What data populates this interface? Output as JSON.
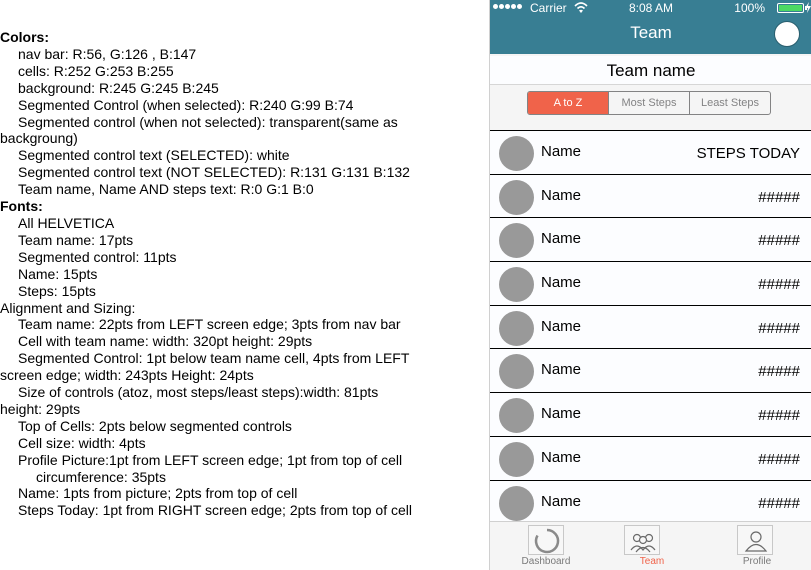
{
  "spec": {
    "lines": [
      {
        "text": "Colors:",
        "level": 0,
        "bold": true
      },
      {
        "text": "nav bar: R:56, G:126 , B:147",
        "level": 1,
        "bold": false
      },
      {
        "text": "cells: R:252 G:253 B:255",
        "level": 1,
        "bold": false
      },
      {
        "text": "background: R:245 G:245 B:245",
        "level": 1,
        "bold": false
      },
      {
        "text": "Segmented Control (when selected): R:240 G:99 B:74",
        "level": 1,
        "bold": false
      },
      {
        "text": "Segmented control (when not selected): transparent(same as",
        "level": 1,
        "bold": false
      },
      {
        "text": "backgroung)",
        "level": 0,
        "bold": false
      },
      {
        "text": "Segmented control text (SELECTED): white",
        "level": 1,
        "bold": false
      },
      {
        "text": "Segmented control text (NOT SELECTED): R:131 G:131 B:132",
        "level": 1,
        "bold": false
      },
      {
        "text": "Team name, Name AND steps text: R:0 G:1 B:0",
        "level": 1,
        "bold": false
      },
      {
        "text": "Fonts:",
        "level": 0,
        "bold": true
      },
      {
        "text": "All HELVETICA",
        "level": 1,
        "bold": false
      },
      {
        "text": "Team name: 17pts",
        "level": 1,
        "bold": false
      },
      {
        "text": "Segmented control: 11pts",
        "level": 1,
        "bold": false
      },
      {
        "text": "Name: 15pts",
        "level": 1,
        "bold": false
      },
      {
        "text": "Steps: 15pts",
        "level": 1,
        "bold": false
      },
      {
        "text": "Alignment and Sizing:",
        "level": 0,
        "bold": false
      },
      {
        "text": "Team name: 22pts from LEFT screen edge; 3pts from nav bar",
        "level": 1,
        "bold": false
      },
      {
        "text": "Cell with team name: width: 320pt height: 29pts",
        "level": 1,
        "bold": false
      },
      {
        "text": "Segmented Control: 1pt below team name cell, 4pts from LEFT",
        "level": 1,
        "bold": false
      },
      {
        "text": "screen edge; width: 243pts Height: 24pts",
        "level": 0,
        "bold": false
      },
      {
        "text": "Size of controls (atoz, most steps/least steps):width: 81pts",
        "level": 1,
        "bold": false
      },
      {
        "text": "height: 29pts",
        "level": 0,
        "bold": false
      },
      {
        "text": "Top of Cells: 2pts below segmented controls",
        "level": 1,
        "bold": false
      },
      {
        "text": "Cell size: width: 4pts",
        "level": 1,
        "bold": false
      },
      {
        "text": "Profile Picture:1pt from LEFT screen edge; 1pt from top of cell",
        "level": 1,
        "bold": false
      },
      {
        "text": "circumference: 35pts",
        "level": 2,
        "bold": false
      },
      {
        "text": "Name: 1pts from picture; 2pts from top of cell",
        "level": 1,
        "bold": false
      },
      {
        "text": "Steps Today: 1pt from RIGHT screen edge; 2pts from top of cell",
        "level": 1,
        "bold": false
      }
    ]
  },
  "phone": {
    "colors": {
      "nav_bar": "#387e93",
      "cells": "#fcfdff",
      "background": "#f5f5f5",
      "segment_selected": "#f0634a",
      "segment_text_unselected": "#838384",
      "avatar": "#999999"
    },
    "status_bar": {
      "carrier": "Carrier",
      "time": "8:08 AM",
      "battery": "100%",
      "battery_level": 1.0
    },
    "nav": {
      "title": "Team"
    },
    "team_name": "Team name",
    "segments": [
      {
        "label": "A to Z",
        "selected": true
      },
      {
        "label": "Most Steps",
        "selected": false
      },
      {
        "label": "Least Steps",
        "selected": false
      }
    ],
    "rows": [
      {
        "name": "Name",
        "steps": "STEPS TODAY"
      },
      {
        "name": "Name",
        "steps": "#####"
      },
      {
        "name": "Name",
        "steps": "#####"
      },
      {
        "name": "Name",
        "steps": "#####"
      },
      {
        "name": "Name",
        "steps": "#####"
      },
      {
        "name": "Name",
        "steps": "#####"
      },
      {
        "name": "Name",
        "steps": "#####"
      },
      {
        "name": "Name",
        "steps": "#####"
      },
      {
        "name": "Name",
        "steps": "#####"
      }
    ],
    "tabs": [
      {
        "label": "Dashboard",
        "icon": "dashboard-ring-icon",
        "active": false
      },
      {
        "label": "Team",
        "icon": "team-group-icon",
        "active": true
      },
      {
        "label": "Profile",
        "icon": "profile-person-icon",
        "active": false
      }
    ]
  }
}
